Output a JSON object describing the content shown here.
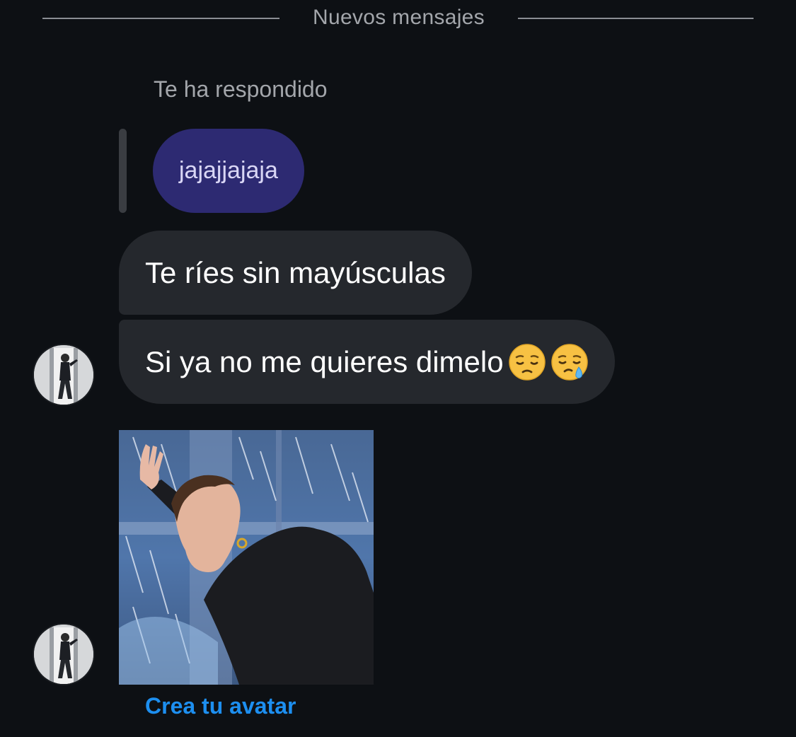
{
  "divider": {
    "label": "Nuevos mensajes"
  },
  "reply": {
    "caption": "Te ha respondido",
    "quoted_text": "jajajjajaja"
  },
  "messages": [
    {
      "text": "Te ríes sin mayúsculas"
    },
    {
      "text": "Si ya no me quieres dimelo",
      "emojis": [
        "pensive-face-emoji",
        "sleepy-face-emoji"
      ]
    }
  ],
  "sticker": {
    "icon": "avatar-sticker-image"
  },
  "cta": {
    "label": "Crea tu avatar"
  },
  "colors": {
    "background": "#0d1014",
    "bubble": "#25282d",
    "quoted_bubble": "#2d2a72",
    "link": "#1d8ff0"
  }
}
